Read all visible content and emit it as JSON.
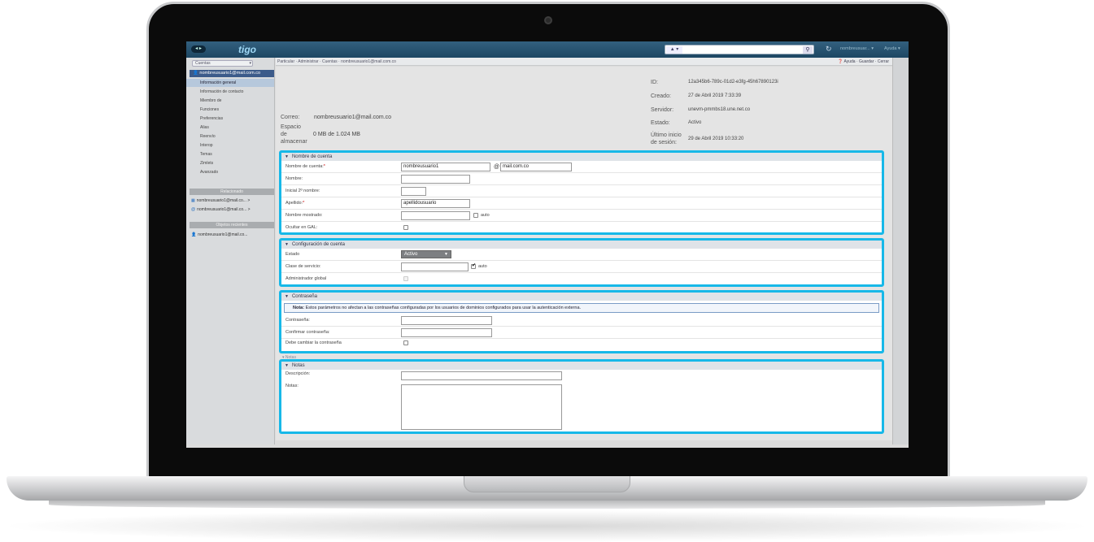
{
  "topbar": {
    "logo": "tigo",
    "nav_arrows": "◂ ▸",
    "account_menu": "▲ ▾",
    "search_value": "",
    "user_menu": "nombreusuar... ▾",
    "help_menu": "Ayuda ▾"
  },
  "sidebar": {
    "select": "Cuentas",
    "account": "nombreusuario1@mail.com.co",
    "items": [
      {
        "label": "Información general"
      },
      {
        "label": "Información de contacto"
      },
      {
        "label": "Miembro de"
      },
      {
        "label": "Funciones"
      },
      {
        "label": "Preferencias"
      },
      {
        "label": "Alias"
      },
      {
        "label": "Reenvío"
      },
      {
        "label": "Interop"
      },
      {
        "label": "Temas"
      },
      {
        "label": "Zimlets"
      },
      {
        "label": "Avanzado"
      }
    ],
    "related_title": "Relacionado",
    "related": [
      {
        "label": "nombreusuario1@mail.co... >"
      },
      {
        "label": "nombreusuario1@mail.co... >"
      }
    ],
    "recent_title": "Objetos recientes",
    "recent": [
      {
        "label": "nombreusuario1@mail.co..."
      }
    ]
  },
  "breadcrumb": {
    "path": "Particular · Administrar · Cuentas · nombreusuario1@mail.com.co",
    "help": "Ayuda",
    "save": "Guardar",
    "close": "Cerrar"
  },
  "header": {
    "correo_label": "Correo:",
    "correo_value": "nombreusuario1@mail.com.co",
    "espacio_label_1": "Espacio",
    "espacio_label_2": "de",
    "espacio_label_3": "almacenar",
    "espacio_value": "0 MB de 1.024 MB",
    "id_label": "ID:",
    "id_value": "12a345b6-789c-01d2-e3fg-45h67890123i",
    "creado_label": "Creado:",
    "creado_value": "27 de Abril 2019 7:33:39",
    "servidor_label": "Servidor:",
    "servidor_value": "unevm-pmmbs18.une.net.co",
    "estado_label": "Estado:",
    "estado_value": "Activo",
    "ultimo_label_1": "Último inicio",
    "ultimo_label_2": "de sesión:",
    "ultimo_value": "29 de Abril 2019 10:33:20"
  },
  "account_name": {
    "title": "Nombre de cuenta",
    "nombre_cuenta_label": "Nombre de cuenta:",
    "nombre_cuenta_value": "nombreusuario1",
    "at": "@",
    "domain_value": "mail.com.co",
    "nombre_label": "Nombre:",
    "nombre_value": "",
    "inicial_label": "Inicial 2º nombre:",
    "inicial_value": "",
    "apellido_label": "Apellido:",
    "apellido_value": "apellidousuario",
    "mostrado_label": "Nombre mostrado:",
    "mostrado_value": "",
    "auto_label": "auto",
    "ocultar_label": "Ocultar en GAL:"
  },
  "account_config": {
    "title": "Configuración de cuenta",
    "estado_label": "Estado",
    "estado_value": "Activo",
    "clase_label": "Clase de servicio:",
    "clase_value": "",
    "auto_label": "auto",
    "admin_label": "Administrador global"
  },
  "password": {
    "title": "Contraseña",
    "note_bold": "Nota:",
    "note_text": " Estos parámetros no afectan a las contraseñas configuradas por los usuarios de dominios configurados para usar la autenticación externa.",
    "pass_label": "Contraseña:",
    "confirm_label": "Confirmar contraseña:",
    "must_change_label": "Debe cambiar la contraseña"
  },
  "notes": {
    "ghost_title": "▾ Notas",
    "title": "Notas",
    "desc_label": "Descripción:",
    "notes_label": "Notas:"
  }
}
